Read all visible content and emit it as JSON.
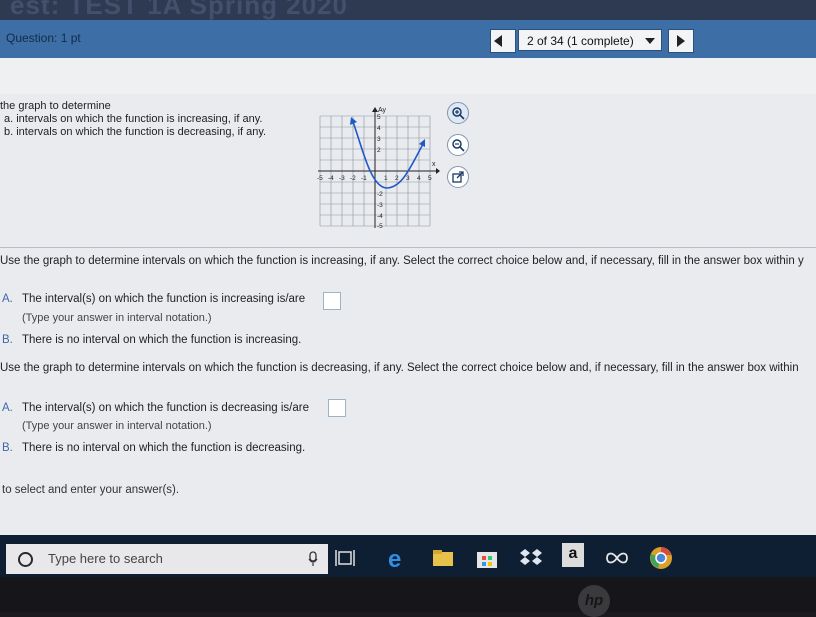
{
  "bezel": {
    "ghost_title": "est: TEST 1A Spring 2020"
  },
  "header": {
    "question_label": "Question: 1 pt",
    "progress": "2 of 34 (1 complete)"
  },
  "instructions": {
    "line1": "the graph to determine",
    "line2": "a. intervals on which the function is increasing, if any.",
    "line3": "b. intervals on which the function is decreasing, if any."
  },
  "graph": {
    "y_axis_label": "Ay",
    "x_axis_label": "x",
    "x_ticks": [
      "-5",
      "-4",
      "-3",
      "-2",
      "-1",
      "1",
      "2",
      "3",
      "4",
      "5"
    ],
    "y_ticks": [
      "5",
      "4",
      "3",
      "2",
      "-2",
      "-3",
      "-4",
      "-5"
    ]
  },
  "part_a": {
    "prompt": "Use the graph to determine intervals on which the function is increasing, if any. Select the correct choice below and, if necessary, fill in the answer box within y",
    "choice_a_letter": "A.",
    "choice_a_text": "The interval(s) on which the function is increasing is/are",
    "choice_a_hint": "(Type your answer in interval notation.)",
    "choice_b_letter": "B.",
    "choice_b_text": "There is no interval on which the function is increasing."
  },
  "part_b": {
    "prompt": "Use the graph to determine intervals on which the function is decreasing, if any. Select the correct choice below and, if necessary, fill in the answer box within",
    "choice_a_letter": "A.",
    "choice_a_text": "The interval(s) on which the function is decreasing is/are",
    "choice_a_hint": "(Type your answer in interval notation.)",
    "choice_b_letter": "B.",
    "choice_b_text": "There is no interval on which the function is decreasing."
  },
  "footer_note": "to select and enter your answer(s).",
  "taskbar": {
    "search_placeholder": "Type here to search",
    "amazon_letter": "a",
    "hp_logo": "hp"
  },
  "colors": {
    "header_bar": "#3e6ea6",
    "curve": "#1f58c9",
    "choice_letter": "#3c6aa8",
    "taskbar": "#0f1f33"
  },
  "icons": [
    "search-ring-icon",
    "microphone-icon",
    "task-view-icon",
    "edge-icon",
    "file-explorer-icon",
    "store-icon",
    "dropbox-icon",
    "amazon-icon",
    "infinity-icon",
    "chrome-icon",
    "zoom-in-icon",
    "zoom-out-icon",
    "open-graph-icon"
  ]
}
